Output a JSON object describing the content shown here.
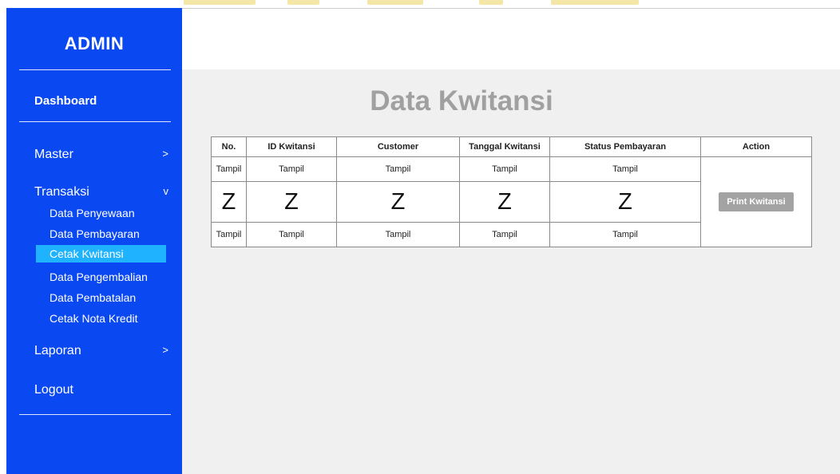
{
  "sidebar": {
    "title": "ADMIN",
    "dashboard": "Dashboard",
    "master": {
      "label": "Master",
      "chevron": ">"
    },
    "transaksi": {
      "label": "Transaksi",
      "chevron": "v",
      "items": [
        {
          "label": "Data Penyewaan"
        },
        {
          "label": "Data Pembayaran"
        },
        {
          "label": "Cetak Kwitansi"
        },
        {
          "label": "Data Pengembalian"
        },
        {
          "label": "Data Pembatalan"
        },
        {
          "label": "Cetak Nota Kredit"
        }
      ],
      "active_item": "Cetak Kwitansi"
    },
    "laporan": {
      "label": "Laporan",
      "chevron": ">"
    },
    "logout": "Logout"
  },
  "main": {
    "title": "Data Kwitansi",
    "table": {
      "headers": [
        "No.",
        "ID Kwitansi",
        "Customer",
        "Tanggal Kwitansi",
        "Status Pembayaran",
        "Action"
      ],
      "rows": [
        [
          "Tampil",
          "Tampil",
          "Tampil",
          "Tampil",
          "Tampil"
        ],
        [
          "Z",
          "Z",
          "Z",
          "Z",
          "Z"
        ],
        [
          "Tampil",
          "Tampil",
          "Tampil",
          "Tampil",
          "Tampil"
        ]
      ],
      "action_button": "Print Kwitansi"
    }
  },
  "colors": {
    "sidebar_bg": "#0a48f2",
    "active_item_bg": "#1fb2ff",
    "content_bg": "#f0f0f0",
    "title_color": "#a0a0a0",
    "button_bg": "#a3a3a3"
  }
}
